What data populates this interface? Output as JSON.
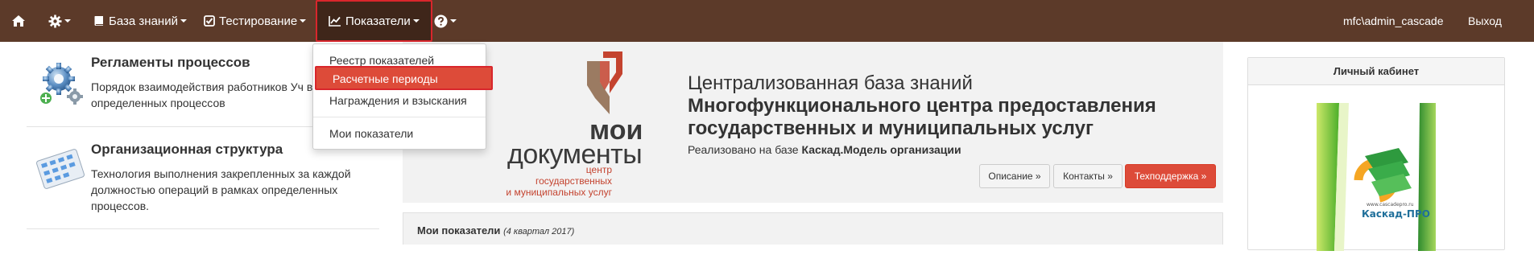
{
  "navbar": {
    "home_icon": "home-icon",
    "settings_icon": "gear-icon",
    "knowledge_base": "База знаний",
    "testing": "Тестирование",
    "indicators": "Показатели",
    "help_icon": "question-circle-icon",
    "user": "mfc\\admin_cascade",
    "logout": "Выход"
  },
  "dropdown": {
    "items": [
      "Реестр показателей",
      "Расчетные периоды",
      "Награждения и взыскания",
      "Мои показатели"
    ],
    "active": "Расчетные периоды"
  },
  "left": [
    {
      "title": "Регламенты процессов",
      "desc": "Порядок взаимодействия работников Уч в рамках определенных процессов",
      "icon": "gears-icon"
    },
    {
      "title": "Организационная структура",
      "desc": "Технология выполнения закрепленных за каждой должностью операций в рамках определенных процессов.",
      "icon": "org-structure-icon"
    }
  ],
  "banner": {
    "logo": {
      "line1": "мои",
      "line2": "документы",
      "sub": [
        "центр",
        "государственных",
        "и муниципальных услуг"
      ]
    },
    "title_line1": "Централизованная база знаний",
    "title_line2": "Многофункционального центра предоставления государственных и муниципальных услуг",
    "impl_prefix": "Реализовано на базе",
    "impl_name": "Каскад.Модель организации",
    "buttons": {
      "description": "Описание »",
      "contacts": "Контакты »",
      "support": "Техподдержка »"
    }
  },
  "my_indicators": {
    "title": "Мои показатели",
    "period": "(4 квартал 2017)"
  },
  "cabinet": {
    "title": "Личный кабинет",
    "logo_url": "www.cascadepro.ru",
    "logo_name": "Каскад-ПРО"
  },
  "colors": {
    "navbar": "#5c3a29",
    "danger": "#dd4b39",
    "panel": "#f2f2f2"
  }
}
